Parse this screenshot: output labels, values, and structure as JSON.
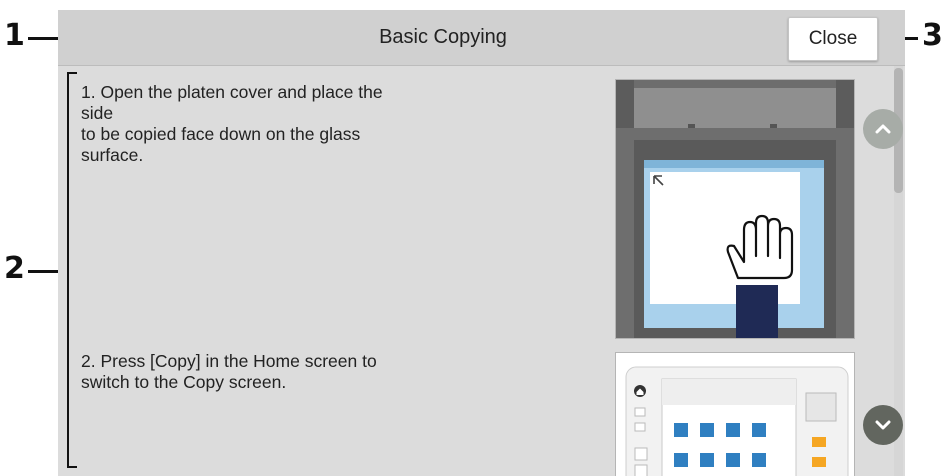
{
  "header": {
    "title": "Basic Copying",
    "close_label": "Close"
  },
  "steps": [
    {
      "text": "1. Open the platen cover and place the\nside\nto be copied face down on the glass\nsurface."
    },
    {
      "text": "2. Press [Copy] in the Home screen to\nswitch to the Copy screen."
    }
  ],
  "callouts": [
    "1",
    "2",
    "3"
  ],
  "icons": {
    "scroll_up": "chevron-up-icon",
    "scroll_down": "chevron-down-icon",
    "home": "home-icon"
  },
  "colors": {
    "screen_bg": "#dcdcdc",
    "titlebar_bg": "#d0d0d0",
    "scroll_up_btn": "#a7aca7",
    "scroll_down_btn": "#62665f",
    "glass_blue": "#a9d1ec"
  }
}
